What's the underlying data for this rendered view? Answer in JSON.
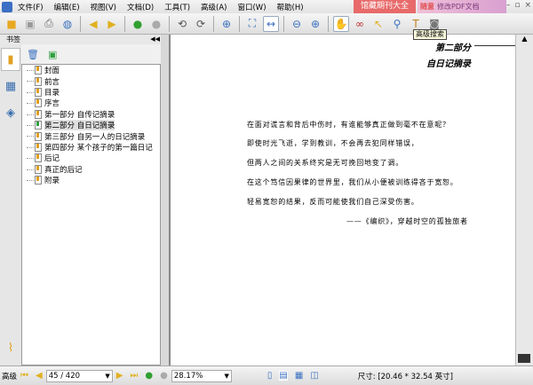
{
  "menu": [
    "文件(F)",
    "编辑(E)",
    "视图(V)",
    "文档(D)",
    "工具(T)",
    "高级(A)",
    "窗口(W)",
    "帮助(H)"
  ],
  "ads": {
    "left": "馆藏期刊大全",
    "right_brand": "随意",
    "right_text": "修改PDF文档"
  },
  "tooltip": "高级搜索",
  "panel": {
    "title": "书签",
    "bookmarks": [
      "封面",
      "前言",
      "目录",
      "序言",
      "第一部分 自传记摘录",
      "第二部分 自日记摘录",
      "第三部分 自另一人的日记摘录",
      "第四部分 某个孩子的第一篇日记",
      "后记",
      "真正的后记",
      "附录"
    ],
    "selected_index": 5
  },
  "page": {
    "header_part": "第二部分",
    "header_title": "自日记摘录",
    "lines": [
      "在面对谎言和背后中伤时，有谁能够真正做到毫不在意呢？",
      "即使时光飞逝，学到教训，不会再去犯同样错误，",
      "但两人之间的关系终究是无可挽回地变了调。",
      "在这个笃信因果律的世界里，我们从小便被训练得吝于宽恕。",
      "轻易宽恕的结果，反而可能使我们自己深受伤害。"
    ],
    "quote": "——《编织》，穿越时空的孤独旅者"
  },
  "status": {
    "mode": "高级",
    "page": "45 / 420",
    "zoom": "28.17%",
    "size": "尺寸: [20.46 * 32.54 英寸]"
  }
}
